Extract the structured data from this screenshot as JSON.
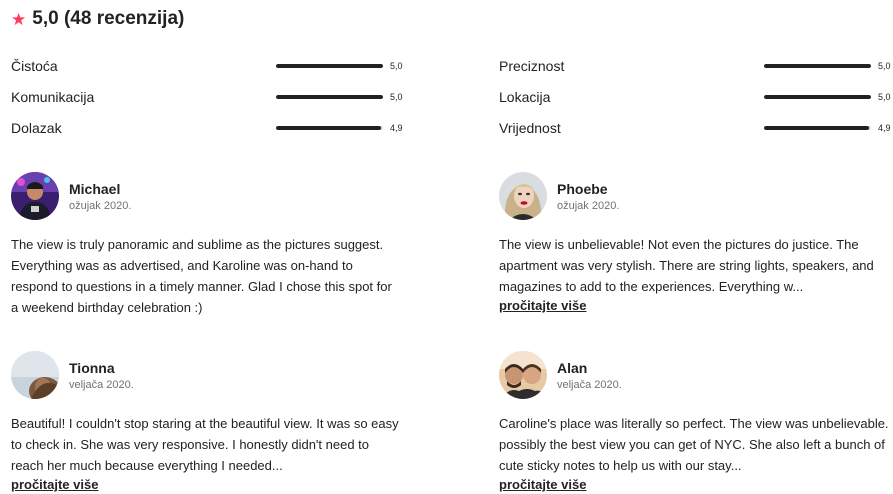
{
  "rating": {
    "icon": "star-icon",
    "star_color": "#FF385C",
    "value": "5,0",
    "count_text": "(48 recenzija)"
  },
  "categories": [
    {
      "label": "Čistoća",
      "score": "5,0",
      "fraction": 1.0
    },
    {
      "label": "Komunikacija",
      "score": "5,0",
      "fraction": 1.0
    },
    {
      "label": "Dolazak",
      "score": "4,9",
      "fraction": 0.98
    },
    {
      "label": "Preciznost",
      "score": "5,0",
      "fraction": 1.0
    },
    {
      "label": "Lokacija",
      "score": "5,0",
      "fraction": 1.0
    },
    {
      "label": "Vrijednost",
      "score": "4,9",
      "fraction": 0.98
    }
  ],
  "reviews": [
    {
      "name": "Michael",
      "date": "ožujak 2020.",
      "text": "The view is truly panoramic and sublime as the pictures suggest. Everything was as advertised, and Karoline was on-hand to respond to questions in a timely manner. Glad I chose this spot for a weekend birthday celebration :)",
      "read_more": ""
    },
    {
      "name": "Phoebe",
      "date": "ožujak 2020.",
      "text": "The view is unbelievable! Not even the pictures do justice. The apartment was very stylish. There are string lights, speakers, and magazines to add to the experiences. Everything w...",
      "read_more": "pročitajte više"
    },
    {
      "name": "Tionna",
      "date": "veljača 2020.",
      "text": "Beautiful! I couldn't stop staring at the beautiful view. It was so easy to check in. She was very responsive. I honestly didn't need to reach her much because everything I needed...",
      "read_more": "pročitajte više"
    },
    {
      "name": "Alan",
      "date": "veljača 2020.",
      "text": "Caroline's place was literally so perfect. The view was unbelievable. possibly the best view you can get of NYC. She also left a bunch of cute sticky notes to help us with our stay...",
      "read_more": "pročitajte više"
    }
  ]
}
